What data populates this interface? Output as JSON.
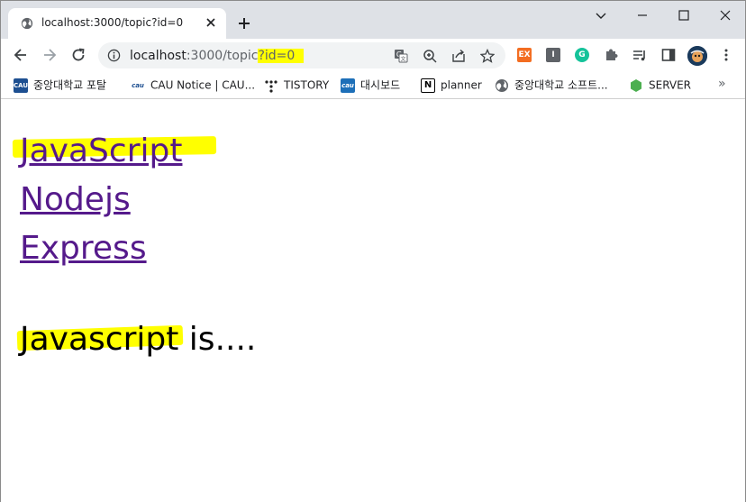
{
  "tab": {
    "title": "localhost:3000/topic?id=0",
    "close_icon": "close-icon",
    "favicon": "globe-icon"
  },
  "new_tab_icon": "plus-icon",
  "window_controls": [
    "chevron-down-icon",
    "minimize-icon",
    "maximize-icon",
    "close-icon"
  ],
  "address_bar": {
    "host": "localhost",
    "path": ":3000/topic",
    "query": "?id=0",
    "icons": [
      "translate-icon",
      "zoom-icon",
      "share-icon",
      "star-icon"
    ]
  },
  "extensions": [
    {
      "name": "ex-extension-icon",
      "label": "EX",
      "color": "#f36d21"
    },
    {
      "name": "i-extension-icon",
      "label": "I",
      "color": "#5f6368"
    },
    {
      "name": "grammarly-icon",
      "label": "G",
      "color": "#15c39a"
    }
  ],
  "toolbar_icons": [
    "puzzle-icon",
    "reading-list-icon",
    "side-panel-icon",
    "profile-avatar",
    "more-vert-icon"
  ],
  "bookmarks": [
    {
      "label": "중앙대학교 포탈",
      "icon_text": "CAU",
      "color": "#1d4f91"
    },
    {
      "label": "CAU Notice | CAU...",
      "icon_text": "cau",
      "color": "#ffffff"
    },
    {
      "label": "TISTORY",
      "icon_text": "T",
      "color": "#ffffff"
    },
    {
      "label": "대시보드",
      "icon_text": "cau",
      "color": "#1d6fb8"
    },
    {
      "label": "planner",
      "icon_text": "N",
      "color": "#000000"
    },
    {
      "label": "중앙대학교 소프트...",
      "icon_text": "",
      "color": "#5f6368"
    },
    {
      "label": "SERVER",
      "icon_text": "",
      "color": "#4caf50"
    }
  ],
  "bookmarks_more": "»",
  "page": {
    "links": [
      "JavaScript",
      "Nodejs",
      "Express"
    ],
    "description": "Javascript is....",
    "highlight_color": "#ffff00",
    "link_color": "#551a8b"
  }
}
